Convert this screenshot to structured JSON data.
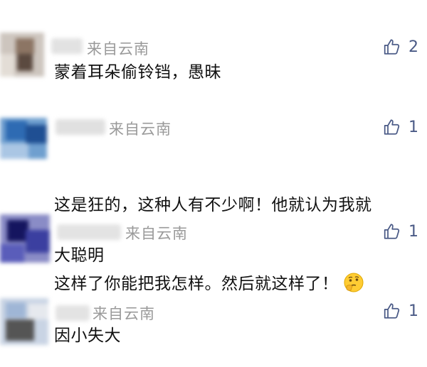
{
  "comments": [
    {
      "location": "来自云南",
      "likes": "2",
      "text": "蒙着耳朵偷铃铛，愚昧"
    },
    {
      "location": "来自云南",
      "likes": "1",
      "text_line1": "这是狂的，这种人有不少啊！他就认为我就",
      "text_line2": "这样了你能把我怎样。然后就这样了！",
      "emoji": "thinking-face-icon"
    },
    {
      "location": "来自云南",
      "likes": "1",
      "text": "大聪明"
    },
    {
      "location": "来自云南",
      "likes": "1",
      "text": "因小失大"
    }
  ],
  "colors": {
    "location": "#9a9a9a",
    "like": "#4a5a86",
    "text": "#111111"
  },
  "icons": {
    "like": "thumbs-up-icon"
  }
}
